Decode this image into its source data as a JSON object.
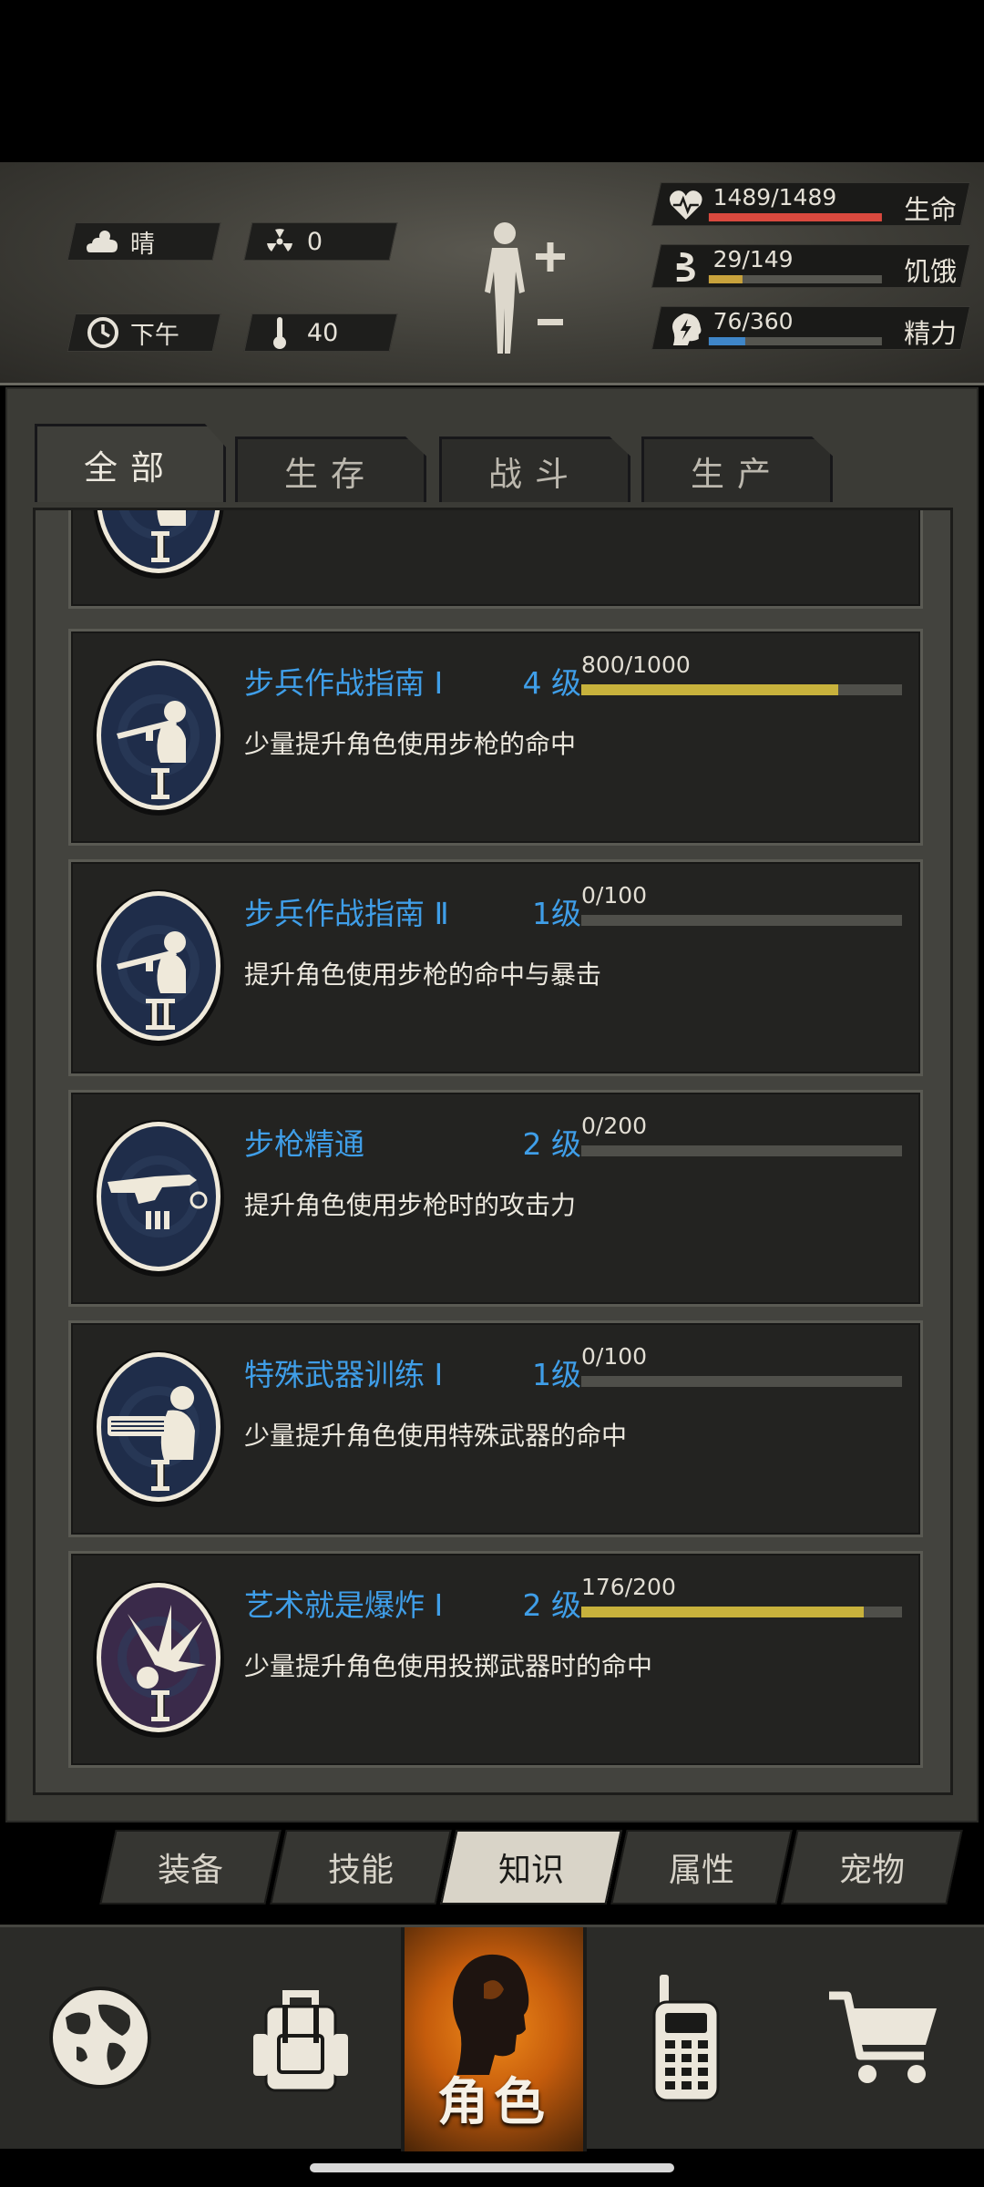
{
  "status": {
    "weather": "晴",
    "radiation": "0",
    "time_of_day": "下午",
    "temperature": "40",
    "stats": [
      {
        "key": "health",
        "value_text": "1489/1489",
        "label": "生命",
        "fraction": 1.0,
        "color": "#d9493e"
      },
      {
        "key": "hunger",
        "value_text": "29/149",
        "label": "饥饿",
        "fraction": 0.195,
        "color": "#c8a23c"
      },
      {
        "key": "energy",
        "value_text": "76/360",
        "label": "精力",
        "fraction": 0.211,
        "color": "#3f86c8"
      }
    ]
  },
  "tabs": [
    {
      "label": "全部",
      "active": true
    },
    {
      "label": "生存",
      "active": false
    },
    {
      "label": "战斗",
      "active": false
    },
    {
      "label": "生产",
      "active": false
    }
  ],
  "knowledge_items": [
    {
      "name": "",
      "level": "",
      "progress_text": "",
      "fraction": 0,
      "desc": "",
      "numeral": "I",
      "icon": "rifleman-icon"
    },
    {
      "name": "步兵作战指南 Ⅰ",
      "level": "4 级",
      "progress_text": "800/1000",
      "fraction": 0.8,
      "desc": "少量提升角色使用步枪的命中",
      "numeral": "I",
      "icon": "rifleman-icon"
    },
    {
      "name": "步兵作战指南 Ⅱ",
      "level": "1级",
      "progress_text": "0/100",
      "fraction": 0.0,
      "desc": "提升角色使用步枪的命中与暴击",
      "numeral": "II",
      "icon": "rifleman-icon"
    },
    {
      "name": "步枪精通",
      "level": "2 级",
      "progress_text": "0/200",
      "fraction": 0.0,
      "desc": "提升角色使用步枪时的攻击力",
      "numeral": "",
      "icon": "rifle-icon"
    },
    {
      "name": "特殊武器训练 Ⅰ",
      "level": "1级",
      "progress_text": "0/100",
      "fraction": 0.0,
      "desc": "少量提升角色使用特殊武器的命中",
      "numeral": "I",
      "icon": "minigun-icon"
    },
    {
      "name": "艺术就是爆炸 Ⅰ",
      "level": "2 级",
      "progress_text": "176/200",
      "fraction": 0.88,
      "desc": "少量提升角色使用投掷武器时的命中",
      "numeral": "I",
      "icon": "explosion-icon"
    }
  ],
  "subnav": [
    {
      "label": "装备",
      "active": false
    },
    {
      "label": "技能",
      "active": false
    },
    {
      "label": "知识",
      "active": true
    },
    {
      "label": "属性",
      "active": false
    },
    {
      "label": "宠物",
      "active": false
    }
  ],
  "bottomnav": {
    "items": [
      {
        "icon": "globe-icon",
        "active": false
      },
      {
        "icon": "backpack-icon",
        "active": false
      },
      {
        "icon": "character-head-icon",
        "active": true,
        "label": "角色"
      },
      {
        "icon": "radio-icon",
        "active": false
      },
      {
        "icon": "shopping-cart-icon",
        "active": false
      }
    ]
  }
}
